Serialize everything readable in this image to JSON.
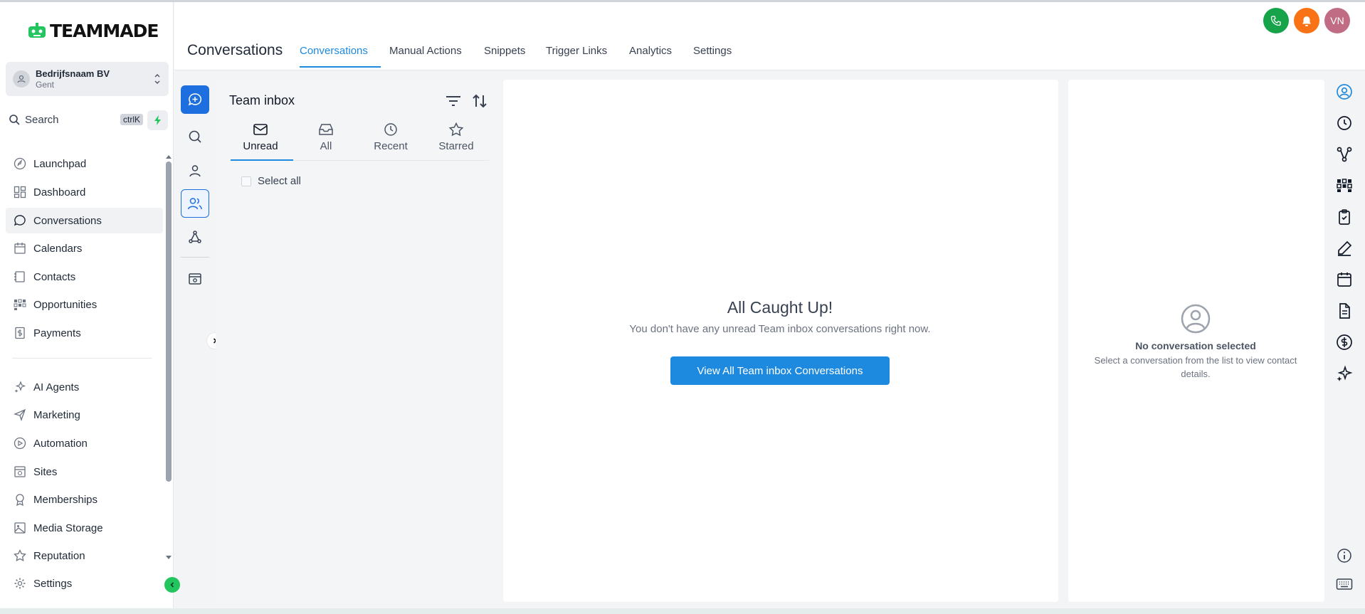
{
  "app": {
    "logo_text": "TEAMMADE"
  },
  "account": {
    "name": "Bedrijfsnaam BV",
    "location": "Gent"
  },
  "search": {
    "label": "Search",
    "shortcut": "ctrlK"
  },
  "sidebar": {
    "items": [
      {
        "label": "Launchpad",
        "icon": "rocket-icon"
      },
      {
        "label": "Dashboard",
        "icon": "dashboard-icon"
      },
      {
        "label": "Conversations",
        "icon": "chat-icon",
        "active": true
      },
      {
        "label": "Calendars",
        "icon": "calendar-icon"
      },
      {
        "label": "Contacts",
        "icon": "contacts-icon"
      },
      {
        "label": "Opportunities",
        "icon": "opportunities-icon"
      },
      {
        "label": "Payments",
        "icon": "payments-icon"
      },
      {
        "label": "AI Agents",
        "icon": "sparkle-icon"
      },
      {
        "label": "Marketing",
        "icon": "send-icon"
      },
      {
        "label": "Automation",
        "icon": "automation-icon"
      },
      {
        "label": "Sites",
        "icon": "sites-icon"
      },
      {
        "label": "Memberships",
        "icon": "award-icon"
      },
      {
        "label": "Media Storage",
        "icon": "image-icon"
      },
      {
        "label": "Reputation",
        "icon": "star-icon"
      },
      {
        "label": "Settings",
        "icon": "gear-icon"
      }
    ]
  },
  "header": {
    "title": "Conversations",
    "tabs": [
      "Conversations",
      "Manual Actions",
      "Snippets",
      "Trigger Links",
      "Analytics",
      "Settings"
    ],
    "active_tab": "Conversations",
    "avatar_initials": "VN",
    "colors": {
      "phone": "#16a34a",
      "bell": "#f97316",
      "avatar": "#c06c84",
      "accent": "#1d8ae0"
    }
  },
  "inbox": {
    "title": "Team inbox",
    "tabs": [
      {
        "label": "Unread",
        "icon": "mail-icon"
      },
      {
        "label": "All",
        "icon": "inbox-icon"
      },
      {
        "label": "Recent",
        "icon": "clock-icon"
      },
      {
        "label": "Starred",
        "icon": "star-icon"
      }
    ],
    "select_all": "Select all"
  },
  "empty_state": {
    "title": "All Caught Up!",
    "subtitle": "You don't have any unread Team inbox conversations right now.",
    "button": "View All Team inbox Conversations"
  },
  "details": {
    "title": "No conversation selected",
    "subtitle": "Select a conversation from the list to view contact details."
  }
}
